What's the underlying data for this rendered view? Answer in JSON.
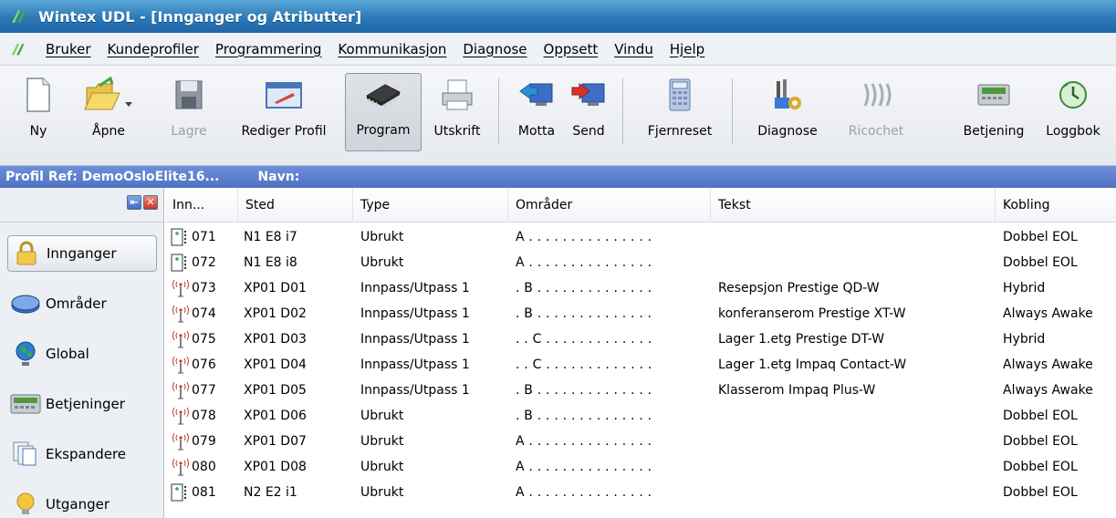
{
  "window": {
    "title": "Wintex UDL - [Innganger og Atributter]"
  },
  "menu": [
    "Bruker",
    "Kundeprofiler",
    "Programmering",
    "Kommunikasjon",
    "Diagnose",
    "Oppsett",
    "Vindu",
    "Hjelp"
  ],
  "toolbar": {
    "buttons": [
      {
        "label": "Ny",
        "icon": "new-document-icon"
      },
      {
        "label": "Åpne",
        "icon": "open-folder-icon"
      },
      {
        "label": "Lagre",
        "icon": "save-disk-icon",
        "disabled": true
      },
      {
        "label": "Rediger Profil",
        "icon": "edit-profile-icon"
      },
      {
        "label": "Program",
        "icon": "chip-icon",
        "pressed": true
      },
      {
        "label": "Utskrift",
        "icon": "printer-icon"
      },
      {
        "label": "Motta",
        "icon": "receive-icon"
      },
      {
        "label": "Send",
        "icon": "send-icon"
      },
      {
        "label": "Fjernreset",
        "icon": "calculator-icon"
      },
      {
        "label": "Diagnose",
        "icon": "diagnostics-icon"
      },
      {
        "label": "Ricochet",
        "icon": "ricochet-icon",
        "disabled": true
      },
      {
        "label": "Betjening",
        "icon": "keypad-icon"
      },
      {
        "label": "Loggbok",
        "icon": "logbook-icon"
      }
    ]
  },
  "profile": {
    "ref": "Profil Ref: DemoOsloElite16...",
    "name_label": "Navn:"
  },
  "nav": {
    "items": [
      {
        "label": "Innganger",
        "icon": "padlock-icon",
        "active": true
      },
      {
        "label": "Områder",
        "icon": "areas-icon"
      },
      {
        "label": "Global",
        "icon": "globe-icon"
      },
      {
        "label": "Betjeninger",
        "icon": "keypad-icon"
      },
      {
        "label": "Ekspandere",
        "icon": "expander-icon"
      },
      {
        "label": "Utganger",
        "icon": "output-bulb-icon"
      }
    ]
  },
  "table": {
    "headers": [
      "Inn...",
      "Sted",
      "Type",
      "Områder",
      "Tekst",
      "Kobling"
    ],
    "rows": [
      {
        "num": "071",
        "icon": "wired-zone-icon",
        "sted": "N1 E8 i7",
        "type": "Ubrukt",
        "omrader": "A . . . . . . . . . . . . . . .",
        "tekst": "",
        "kobling": "Dobbel EOL"
      },
      {
        "num": "072",
        "icon": "wired-zone-icon",
        "sted": "N1 E8 i8",
        "type": "Ubrukt",
        "omrader": "A . . . . . . . . . . . . . . .",
        "tekst": "",
        "kobling": "Dobbel EOL"
      },
      {
        "num": "073",
        "icon": "wireless-zone-icon",
        "sted": "XP01 D01",
        "type": "Innpass/Utpass 1",
        "omrader": ". B . . . . . . . . . . . . . .",
        "tekst": "Resepsjon Prestige QD-W",
        "kobling": "Hybrid"
      },
      {
        "num": "074",
        "icon": "wireless-zone-icon",
        "sted": "XP01 D02",
        "type": "Innpass/Utpass 1",
        "omrader": ". B . . . . . . . . . . . . . .",
        "tekst": "konferanserom Prestige XT-W",
        "kobling": "Always Awake"
      },
      {
        "num": "075",
        "icon": "wireless-zone-icon",
        "sted": "XP01 D03",
        "type": "Innpass/Utpass 1",
        "omrader": ". . C . . . . . . . . . . . . .",
        "tekst": "Lager 1.etg Prestige DT-W",
        "kobling": "Hybrid"
      },
      {
        "num": "076",
        "icon": "wireless-zone-icon",
        "sted": "XP01 D04",
        "type": "Innpass/Utpass 1",
        "omrader": ". . C . . . . . . . . . . . . .",
        "tekst": "Lager 1.etg Impaq Contact-W",
        "kobling": "Always Awake"
      },
      {
        "num": "077",
        "icon": "wireless-zone-icon",
        "sted": "XP01 D05",
        "type": "Innpass/Utpass 1",
        "omrader": ". B . . . . . . . . . . . . . .",
        "tekst": "Klasserom Impaq Plus-W",
        "kobling": "Always Awake"
      },
      {
        "num": "078",
        "icon": "wireless-zone-icon",
        "sted": "XP01 D06",
        "type": "Ubrukt",
        "omrader": ". B . . . . . . . . . . . . . .",
        "tekst": "",
        "kobling": "Dobbel EOL"
      },
      {
        "num": "079",
        "icon": "wireless-zone-icon",
        "sted": "XP01 D07",
        "type": "Ubrukt",
        "omrader": "A . . . . . . . . . . . . . . .",
        "tekst": "",
        "kobling": "Dobbel EOL"
      },
      {
        "num": "080",
        "icon": "wireless-zone-icon",
        "sted": "XP01 D08",
        "type": "Ubrukt",
        "omrader": "A . . . . . . . . . . . . . . .",
        "tekst": "",
        "kobling": "Dobbel EOL"
      },
      {
        "num": "081",
        "icon": "wired-zone-icon",
        "sted": "N2 E2 i1",
        "type": "Ubrukt",
        "omrader": "A . . . . . . . . . . . . . . .",
        "tekst": "",
        "kobling": "Dobbel EOL"
      }
    ]
  },
  "colors": {
    "title_bar": "#2b78b8",
    "profile_bar": "#5a7dcc",
    "wireless_icon": "#c0392b"
  }
}
